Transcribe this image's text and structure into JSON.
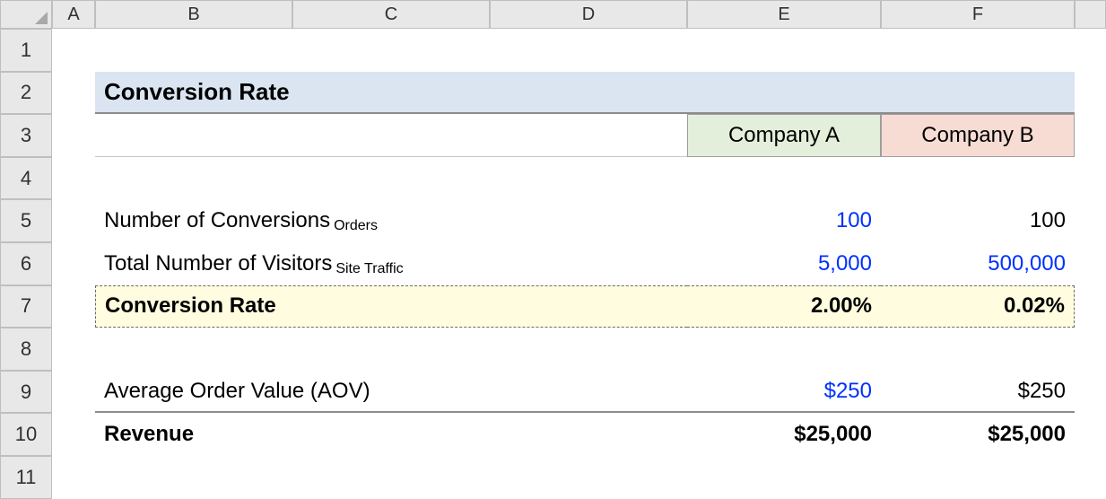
{
  "columns": [
    "A",
    "B",
    "C",
    "D",
    "E",
    "F"
  ],
  "rows": [
    "1",
    "2",
    "3",
    "4",
    "5",
    "6",
    "7",
    "8",
    "9",
    "10",
    "11"
  ],
  "title": "Conversion Rate",
  "companies": {
    "a": "Company A",
    "b": "Company B"
  },
  "labels": {
    "conversions": "Number of Conversions",
    "conversions_sub": "Orders",
    "visitors": "Total Number of Visitors",
    "visitors_sub": "Site Traffic",
    "conversion_rate": "Conversion Rate",
    "aov": "Average Order Value (AOV)",
    "revenue": "Revenue"
  },
  "values": {
    "a": {
      "conversions": "100",
      "visitors": "5,000",
      "rate": "2.00%",
      "aov": "$250",
      "revenue": "$25,000"
    },
    "b": {
      "conversions": "100",
      "visitors": "500,000",
      "rate": "0.02%",
      "aov": "$250",
      "revenue": "$25,000"
    }
  }
}
